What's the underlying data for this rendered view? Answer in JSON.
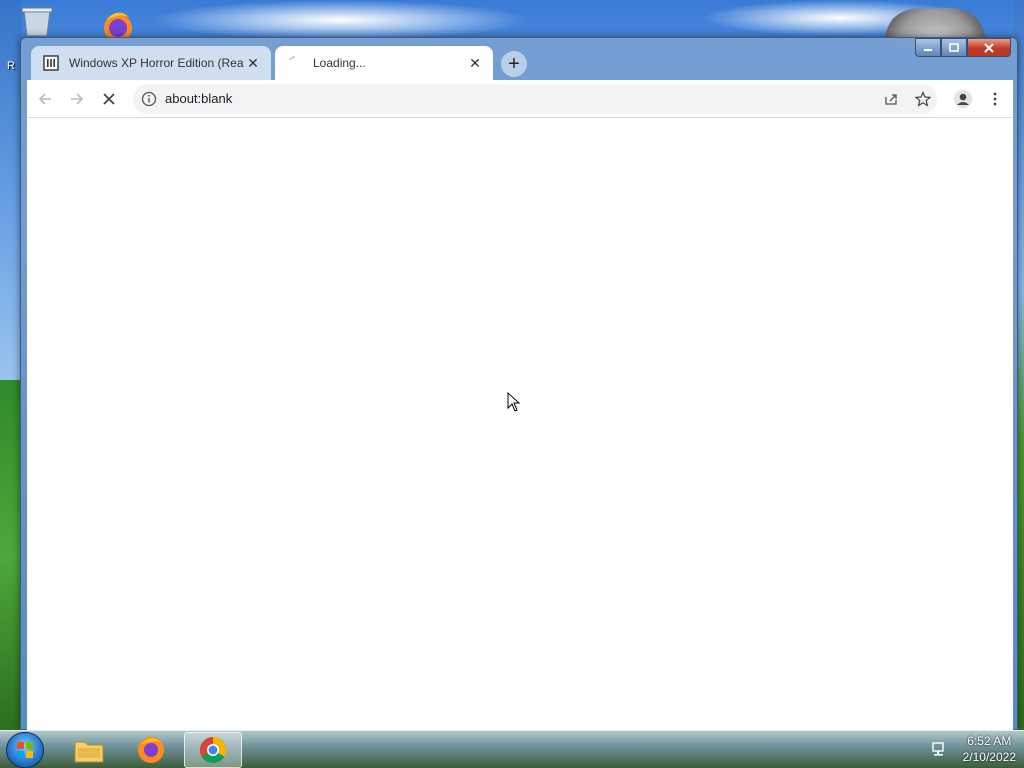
{
  "desktop": {
    "recycle_bin_label_partial": "R"
  },
  "browser": {
    "tabs": [
      {
        "title": "Windows XP Horror Edition (Rea",
        "favicon": "institution-icon",
        "state": "inactive"
      },
      {
        "title": "Loading...",
        "favicon": "loading-spinner-icon",
        "state": "active"
      }
    ],
    "new_tab_label": "+",
    "address_bar": {
      "url": "about:blank"
    },
    "window_controls": {
      "minimize": "minimize-icon",
      "maximize": "maximize-icon",
      "close": "close-icon"
    }
  },
  "taskbar": {
    "pinned": [
      "folder-icon",
      "firefox-icon",
      "chrome-icon"
    ],
    "active_app": "chrome-icon",
    "clock": {
      "time": "6:52 AM",
      "date": "2/10/2022"
    }
  }
}
